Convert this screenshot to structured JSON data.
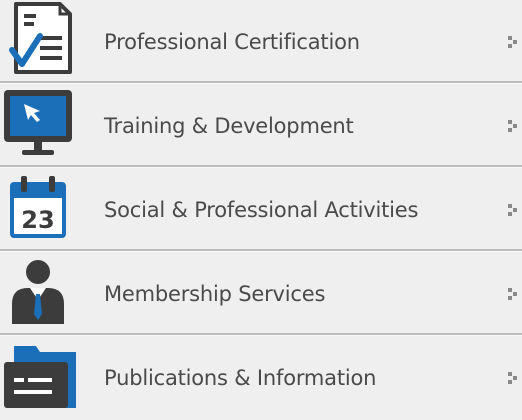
{
  "menu": {
    "items": [
      {
        "label": "Professional Certification",
        "icon": "certificate-checklist-icon"
      },
      {
        "label": "Training & Development",
        "icon": "monitor-cursor-icon"
      },
      {
        "label": "Social & Professional Activities",
        "icon": "calendar-icon",
        "calendar_day": "23"
      },
      {
        "label": "Membership Services",
        "icon": "member-person-icon"
      },
      {
        "label": "Publications & Information",
        "icon": "folder-document-icon"
      }
    ],
    "arrow_icon": "chevron-right-dotted-icon"
  },
  "colors": {
    "background": "#efefef",
    "text": "#4a4a4a",
    "icon_blue": "#1a6fb8",
    "icon_dark": "#3c3c3c",
    "divider": "#bdbdbd"
  }
}
